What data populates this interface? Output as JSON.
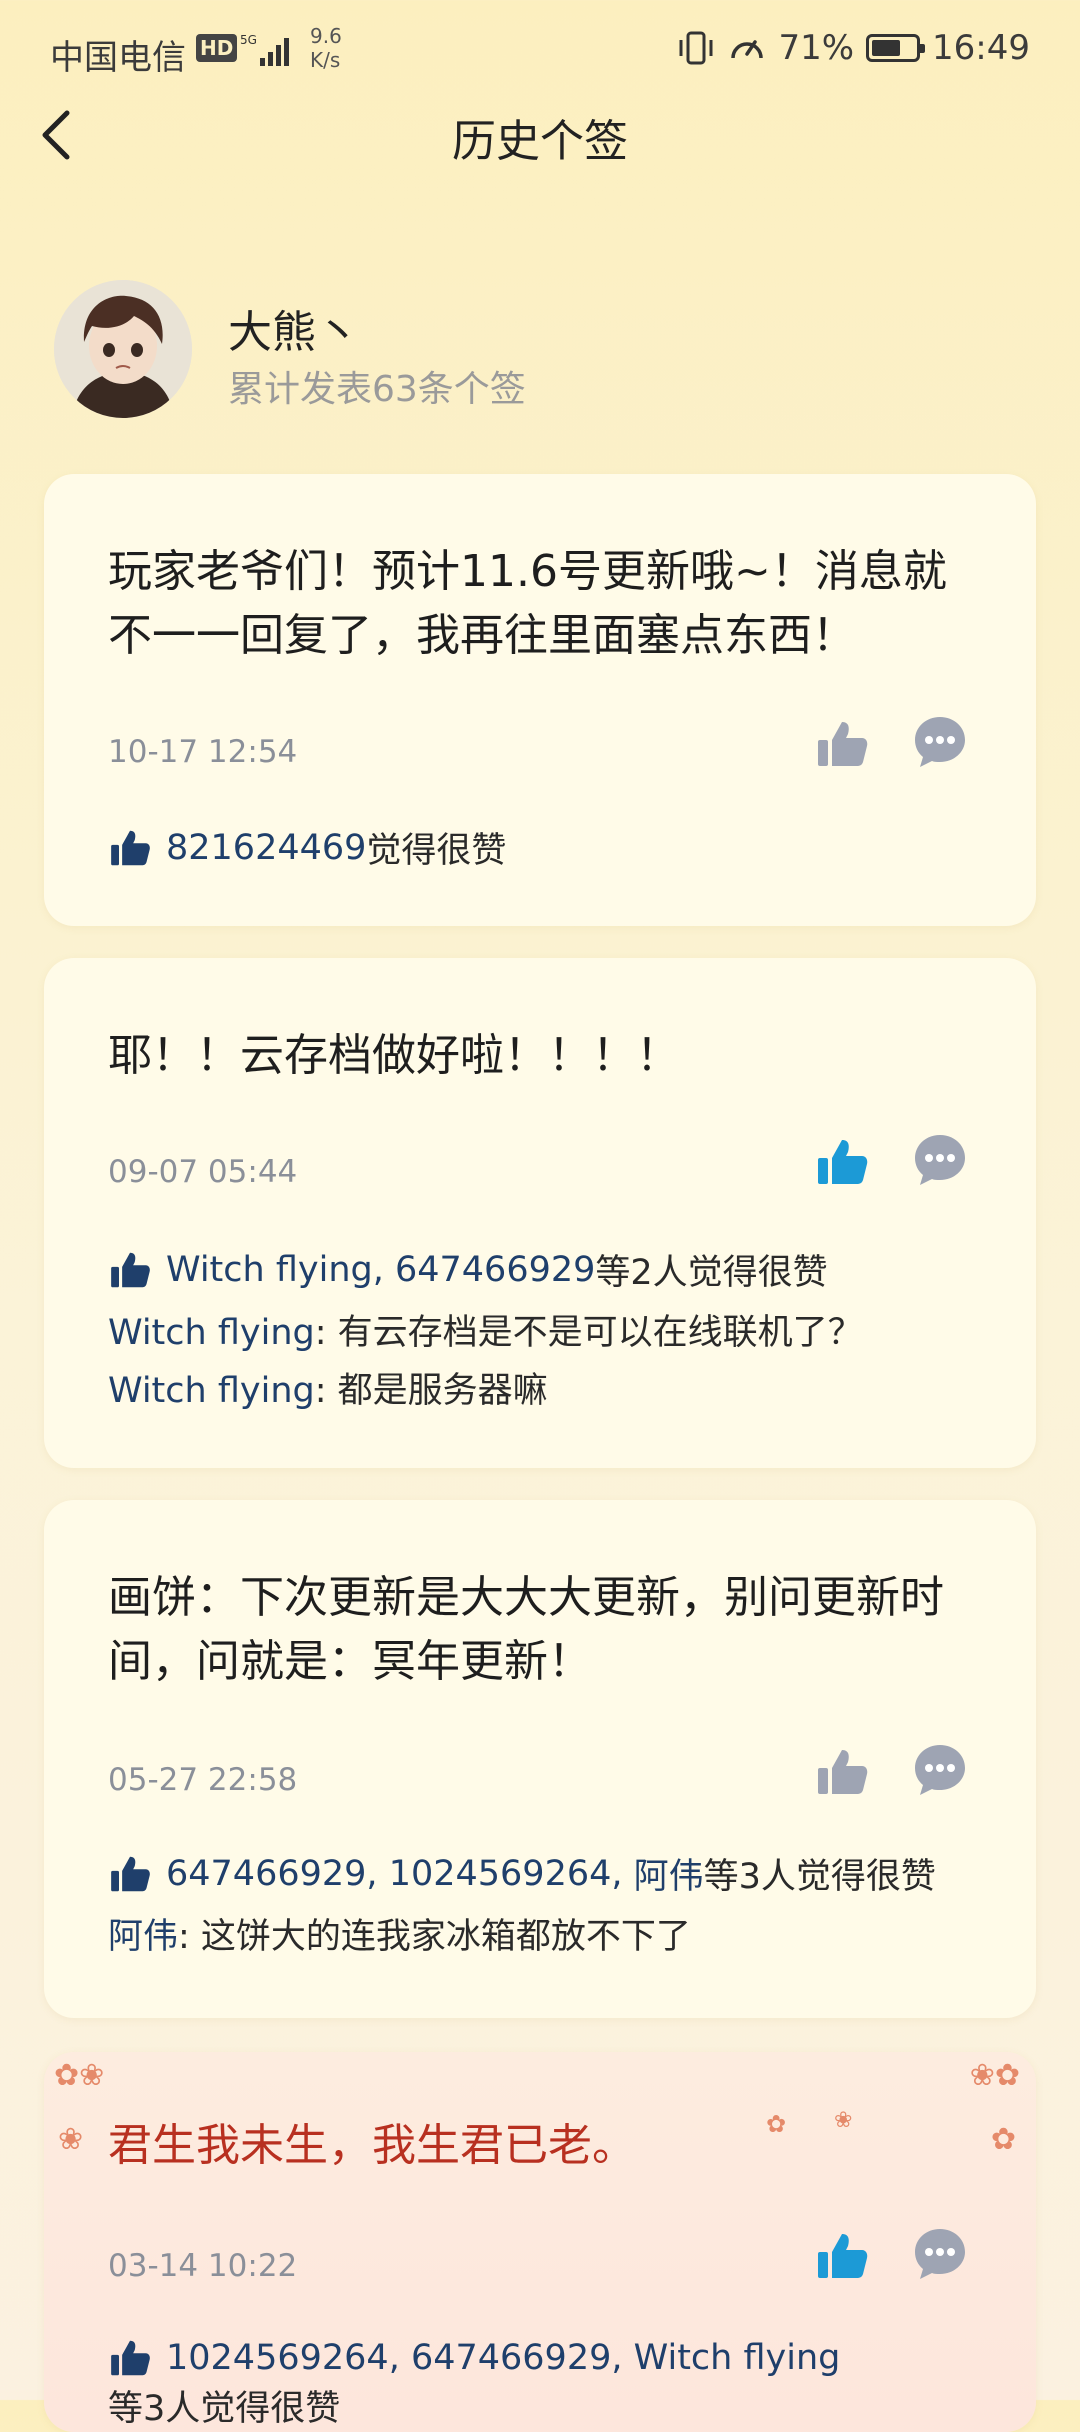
{
  "status_bar": {
    "carrier": "中国电信",
    "hd": "HD",
    "speed_value": "9.6",
    "speed_unit": "K/s",
    "battery_percent": "71%",
    "battery_level": 0.71,
    "time": "16:49"
  },
  "header": {
    "title": "历史个签"
  },
  "profile": {
    "username": "大熊丶",
    "post_count": "累计发表63条个签"
  },
  "posts": [
    {
      "text": "玩家老爷们！预计11.6号更新哦~！消息就不一一回复了，我再往里面塞点东西！",
      "time": "10-17 12:54",
      "liked": false,
      "likers": [
        "821624469"
      ],
      "likes_suffix": "觉得很赞",
      "comments": []
    },
    {
      "text": "耶！！云存档做好啦！！！！",
      "time": "09-07 05:44",
      "liked": true,
      "likers": [
        "Witch flying",
        "647466929"
      ],
      "likes_suffix": "等2人觉得很赞",
      "comments": [
        {
          "user": "Witch flying",
          "text": ": 有云存档是不是可以在线联机了？"
        },
        {
          "user": "Witch flying",
          "text": ": 都是服务器嘛"
        }
      ]
    },
    {
      "text": "画饼：下次更新是大大大更新，别问更新时间，问就是：冥年更新！",
      "time": "05-27 22:58",
      "liked": false,
      "likers": [
        "647466929",
        "1024569264",
        "阿伟"
      ],
      "likes_suffix": "等3人觉得很赞",
      "comments": [
        {
          "user": "阿伟",
          "text": ": 这饼大的连我家冰箱都放不下了"
        }
      ]
    },
    {
      "text": "君生我未生，我生君已老。",
      "time": "03-14 10:22",
      "liked": true,
      "likers": [
        "1024569264",
        "647466929",
        "Witch flying"
      ],
      "likes_suffix": "等3人觉得很赞",
      "comments": []
    }
  ],
  "colors": {
    "liked": "#1c9ad6",
    "unliked": "#9ea4b3",
    "link": "#1f3f6b",
    "special_text": "#b83020"
  },
  "icons": [
    "back-arrow-icon",
    "thumbs-up-icon",
    "comment-icon"
  ]
}
